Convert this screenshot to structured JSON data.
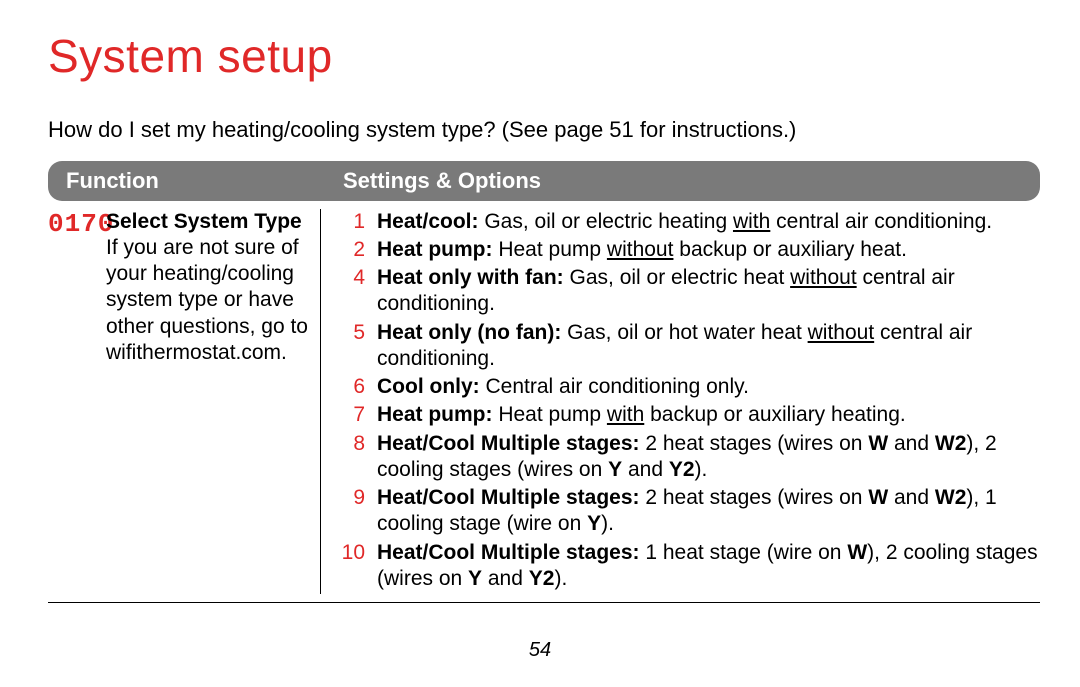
{
  "title": "System setup",
  "intro": "How do I set my heating/cooling system type? (See page 51 for instructions.)",
  "header": {
    "function": "Function",
    "settings": "Settings & Options"
  },
  "function": {
    "code": "0170",
    "name": "Select System Type",
    "note": "If you are not sure of your heating/cooling system type or have other questions, go to wifithermostat.com."
  },
  "options": [
    {
      "n": "1",
      "lead": "Heat/cool:",
      "pre": " Gas, oil or electric heating ",
      "u": "with",
      "post": " central air conditioning."
    },
    {
      "n": "2",
      "lead": "Heat pump:",
      "pre": " Heat pump ",
      "u": "without",
      "post": " backup or auxiliary heat."
    },
    {
      "n": "4",
      "lead": "Heat only with fan:",
      "pre": " Gas, oil or electric heat ",
      "u": "without",
      "post": " central air conditioning."
    },
    {
      "n": "5",
      "lead": "Heat only (no fan):",
      "pre": " Gas, oil or hot water heat ",
      "u": "without",
      "post": " central air conditioning."
    },
    {
      "n": "6",
      "lead": "Cool only:",
      "pre": " Central air conditioning only.",
      "u": "",
      "post": ""
    },
    {
      "n": "7",
      "lead": "Heat pump:",
      "pre": " Heat pump ",
      "u": "with",
      "post": " backup or auxiliary heating."
    },
    {
      "n": "8",
      "lead": "Heat/Cool Multiple stages:",
      "html": " 2 heat stages (wires on <span class='b'>W</span> and <span class='b'>W2</span>), 2 cooling stages (wires on <span class='b'>Y</span> and <span class='b'>Y2</span>)."
    },
    {
      "n": "9",
      "lead": "Heat/Cool Multiple stages:",
      "html": " 2 heat stages (wires on <span class='b'>W</span> and <span class='b'>W2</span>), 1 cooling stage (wire on <span class='b'>Y</span>)."
    },
    {
      "n": "10",
      "lead": "Heat/Cool Multiple stages:",
      "html": " 1 heat stage (wire on <span class='b'>W</span>), 2 cooling stages (wires on <span class='b'>Y</span> and <span class='b'>Y2</span>)."
    }
  ],
  "page_number": "54"
}
